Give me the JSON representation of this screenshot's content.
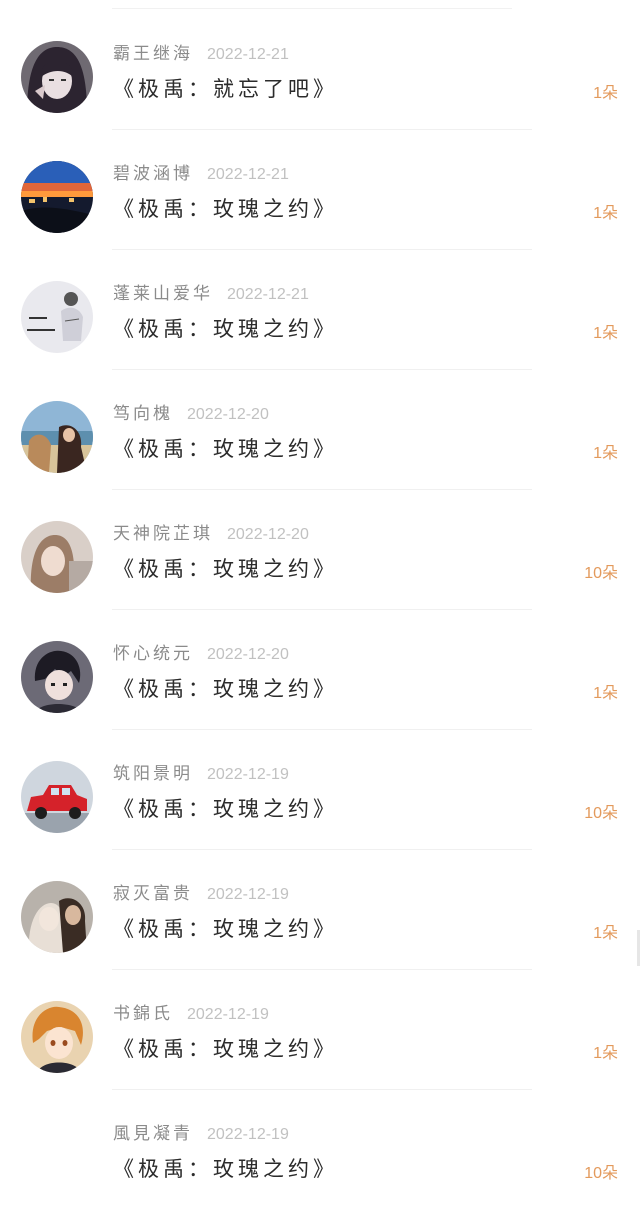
{
  "comments": [
    {
      "name": "霸王继海",
      "date": "2022-12-21",
      "title": "《极禹：就忘了吧》",
      "count": "1朵",
      "avatar": "anime-girl-avatar"
    },
    {
      "name": "碧波涵博",
      "date": "2022-12-21",
      "title": "《极禹：玫瑰之约》",
      "count": "1朵",
      "avatar": "night-city-avatar"
    },
    {
      "name": "蓬莱山爱华",
      "date": "2022-12-21",
      "title": "《极禹：玫瑰之约》",
      "count": "1朵",
      "avatar": "sketch-avatar"
    },
    {
      "name": "笃向槐",
      "date": "2022-12-20",
      "title": "《极禹：玫瑰之约》",
      "count": "1朵",
      "avatar": "beach-girl-avatar"
    },
    {
      "name": "天神院芷琪",
      "date": "2022-12-20",
      "title": "《极禹：玫瑰之约》",
      "count": "10朵",
      "avatar": "blurred-girl-avatar"
    },
    {
      "name": "怀心统元",
      "date": "2022-12-20",
      "title": "《极禹：玫瑰之约》",
      "count": "1朵",
      "avatar": "anime-boy-avatar"
    },
    {
      "name": "筑阳景明",
      "date": "2022-12-19",
      "title": "《极禹：玫瑰之约》",
      "count": "10朵",
      "avatar": "red-car-avatar"
    },
    {
      "name": "寂灭富贵",
      "date": "2022-12-19",
      "title": "《极禹：玫瑰之约》",
      "count": "1朵",
      "avatar": "couple-photo-avatar"
    },
    {
      "name": "书錦氏",
      "date": "2022-12-19",
      "title": "《极禹：玫瑰之约》",
      "count": "1朵",
      "avatar": "anime-redhead-avatar"
    },
    {
      "name": "風見凝青",
      "date": "2022-12-19",
      "title": "《极禹：玫瑰之约》",
      "count": "10朵",
      "avatar": "none"
    }
  ],
  "colors": {
    "name": "#8b8b8b",
    "date": "#c1c1c1",
    "title": "#2b2b2b",
    "count": "#e39a5c"
  }
}
